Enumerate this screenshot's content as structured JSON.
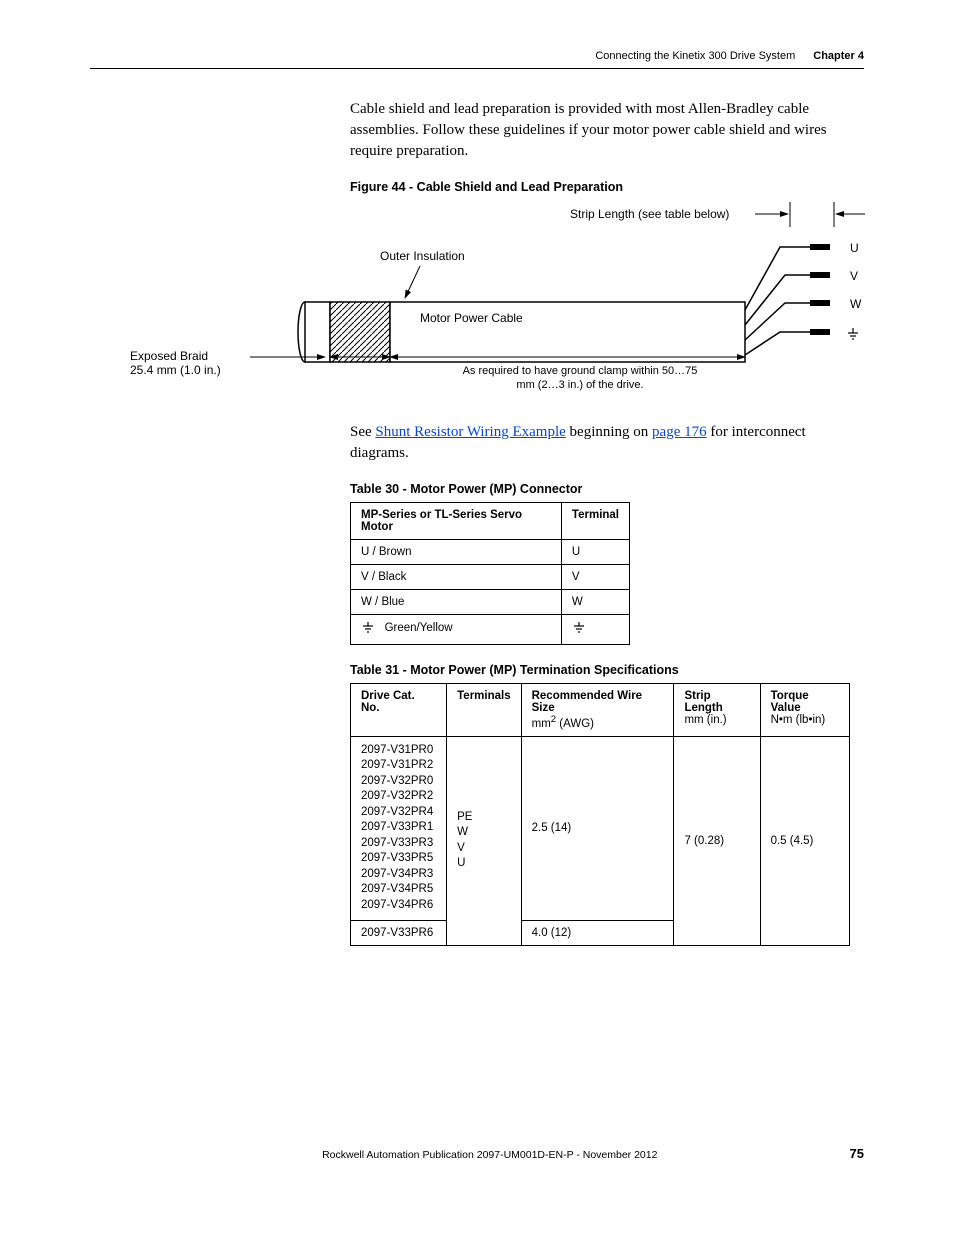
{
  "header": {
    "title": "Connecting the Kinetix 300 Drive System",
    "chapter": "Chapter 4"
  },
  "intro_para": "Cable shield and lead preparation is provided with most Allen-Bradley cable assemblies. Follow these guidelines if your motor power cable shield and wires require preparation.",
  "figure": {
    "caption": "Figure 44 - Cable Shield and Lead Preparation",
    "strip_label": "Strip Length (see table below)",
    "outer_insulation": "Outer Insulation",
    "motor_power_cable": "Motor Power Cable",
    "as_required": "As required to have ground clamp within 50…75 mm (2…3 in.) of the drive.",
    "exposed_braid_l1": "Exposed Braid",
    "exposed_braid_l2": "25.4 mm (1.0 in.)",
    "wires": {
      "u": "U",
      "v": "V",
      "w": "W"
    }
  },
  "see_link_pre": "See ",
  "see_link_text": "Shunt Resistor Wiring Example",
  "see_link_mid": " beginning on ",
  "see_link_page": "page 176",
  "see_link_post": " for interconnect diagrams.",
  "table30": {
    "caption": "Table 30 - Motor Power (MP) Connector",
    "headers": {
      "c1": "MP-Series or TL-Series Servo Motor",
      "c2": "Terminal"
    },
    "rows": [
      {
        "c1": "U / Brown",
        "c2": "U"
      },
      {
        "c1": "V / Black",
        "c2": "V"
      },
      {
        "c1": "W / Blue",
        "c2": "W"
      },
      {
        "c1": "Green/Yellow",
        "c2_gnd": true
      }
    ]
  },
  "table31": {
    "caption": "Table 31 - Motor Power (MP) Termination Specifications",
    "headers": {
      "c1": "Drive Cat. No.",
      "c2": "Terminals",
      "c3a": "Recommended Wire Size",
      "c3b": "mm",
      "c3c": " (AWG)",
      "c4a": "Strip Length",
      "c4b": "mm (in.)",
      "c5a": "Torque Value",
      "c5b": "N•m (lb•in)"
    },
    "row1": {
      "cats": "2097-V31PR0\n2097-V31PR2\n2097-V32PR0\n2097-V32PR2\n2097-V32PR4\n2097-V33PR1\n2097-V33PR3\n2097-V33PR5\n2097-V34PR3\n2097-V34PR5\n2097-V34PR6",
      "terminals": "PE\nW\nV\nU",
      "wire": "2.5 (14)",
      "strip": "7 (0.28)",
      "torque": "0.5 (4.5)"
    },
    "row2": {
      "cats": "2097-V33PR6",
      "wire": "4.0 (12)"
    }
  },
  "footer": {
    "pub": "Rockwell Automation Publication 2097-UM001D-EN-P - November 2012",
    "page": "75"
  }
}
